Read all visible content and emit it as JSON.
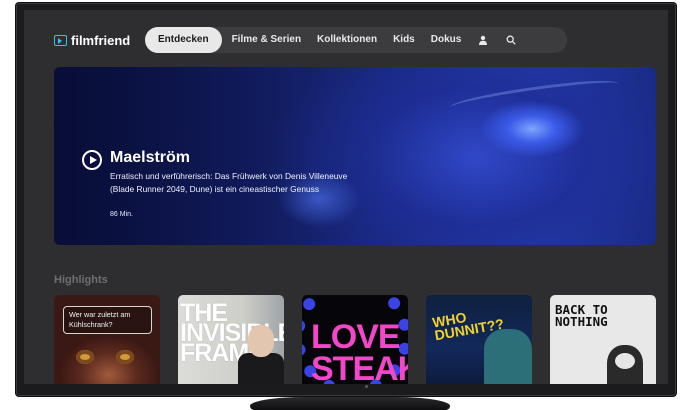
{
  "app": {
    "brand": "filmfriend"
  },
  "nav": {
    "items": [
      {
        "label": "Entdecken",
        "active": true
      },
      {
        "label": "Filme & Serien"
      },
      {
        "label": "Kollektionen"
      },
      {
        "label": "Kids"
      },
      {
        "label": "Dokus"
      }
    ],
    "icons": [
      "user-icon",
      "search-icon"
    ]
  },
  "hero": {
    "title": "Maelström",
    "description": "Erratisch und verführerisch: Das Frühwerk von Denis Villeneuve (Blade Runner 2049, Dune) ist ein cineastischer Genuss",
    "duration": "86 Min."
  },
  "highlights": {
    "title": "Highlights",
    "tiles": [
      {
        "text": "Wer war zuletzt am Kühlschrank?"
      },
      {
        "text": "THE INVISIBLE FRAME"
      },
      {
        "text": "LOVE STEAKS"
      },
      {
        "text": "WHO DUNNIT??"
      },
      {
        "text": "BACK TO NOTHING"
      }
    ]
  },
  "colors": {
    "brand_accent": "#35c3e0",
    "screen_bg": "#2e2e30",
    "nav_bg": "#3c3c3f",
    "active_pill": "#e8e8e8"
  }
}
